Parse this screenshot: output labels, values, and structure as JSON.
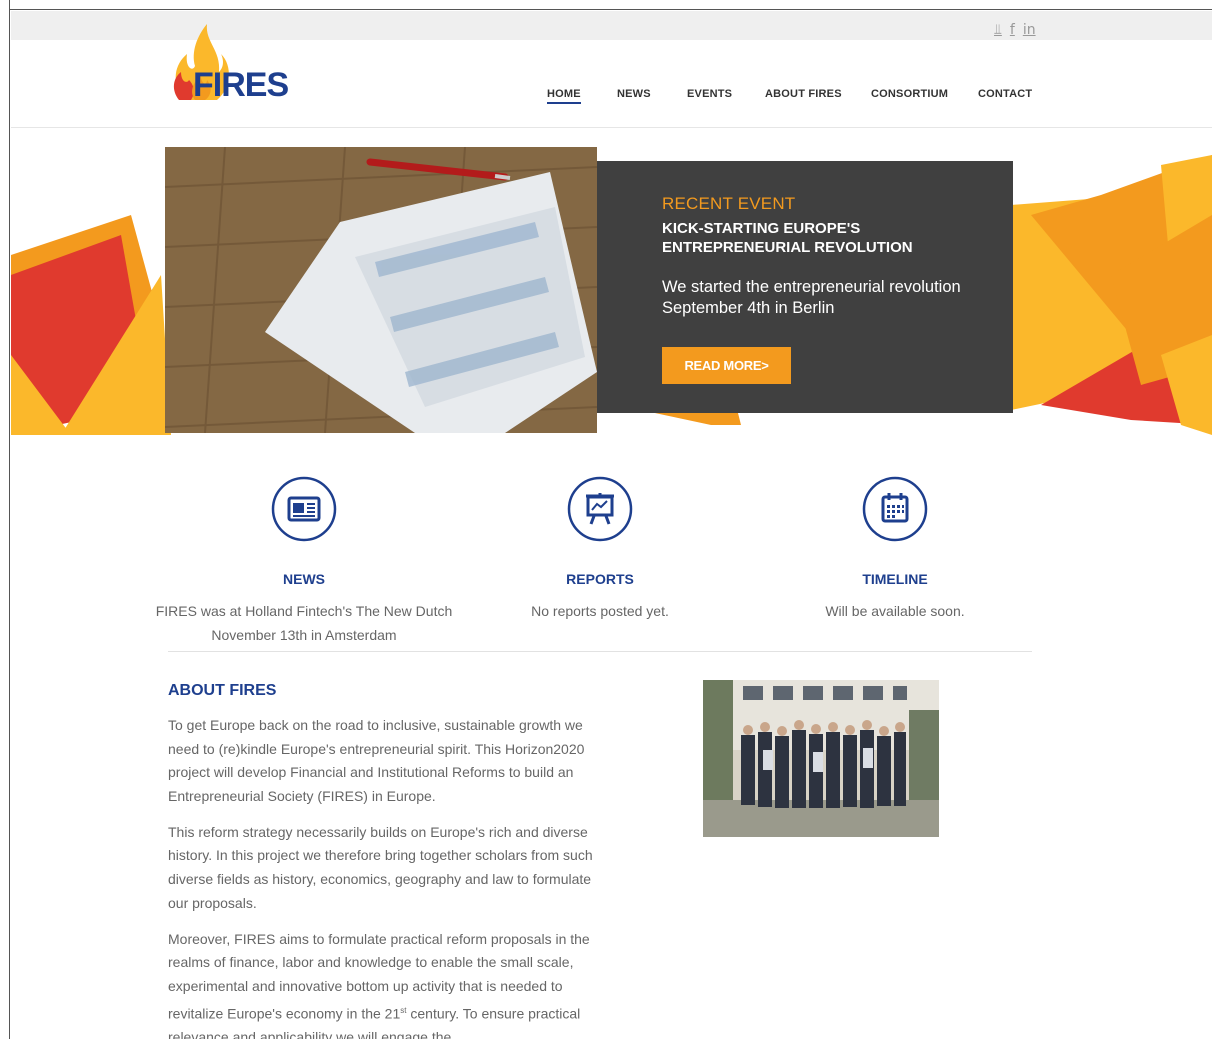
{
  "social": {
    "twitter": "⫫",
    "facebook": "f",
    "linkedin": "in"
  },
  "logo": {
    "text": "FIRES"
  },
  "nav": {
    "items": [
      {
        "label": "HOME",
        "active": true
      },
      {
        "label": "NEWS",
        "active": false
      },
      {
        "label": "EVENTS",
        "active": false
      },
      {
        "label": "ABOUT FIRES",
        "active": false
      },
      {
        "label": "CONSORTIUM",
        "active": false
      },
      {
        "label": "CONTACT",
        "active": false
      }
    ]
  },
  "hero": {
    "kicker": "RECENT EVENT",
    "title": "KICK-STARTING EUROPE'S ENTREPRENEURIAL REVOLUTION",
    "text": "We started the entrepreneurial revolution September 4th in Berlin",
    "button": "READ MORE>"
  },
  "features": [
    {
      "icon": "newspaper-icon",
      "title": "NEWS",
      "text": "FIRES was at Holland Fintech's The New Dutch November 13th in Amsterdam"
    },
    {
      "icon": "presentation-chart-icon",
      "title": "REPORTS",
      "text": "No reports posted yet."
    },
    {
      "icon": "calendar-icon",
      "title": "TIMELINE",
      "text": "Will be available soon."
    }
  ],
  "about": {
    "title": "ABOUT FIRES",
    "p1": "To get Europe back on the road to inclusive, sustainable growth we need to (re)kindle Europe's entrepreneurial spirit. This Horizon2020 project will develop Financial and Institutional Reforms to build an Entrepreneurial Society (FIRES) in Europe.",
    "p2": "This reform strategy necessarily builds on Europe's rich and diverse history. In this project we therefore bring together scholars from such diverse fields as history, economics, geography and law to formulate our proposals.",
    "p3_a": "Moreover, FIRES aims to formulate practical reform proposals in the realms of finance, labor and knowledge to enable the small scale, experimental and innovative bottom up activity that is needed to revitalize Europe's economy in the 21",
    "p3_sup": "st",
    "p3_b": " century. To ensure practical relevance and applicability we will engage the"
  },
  "colors": {
    "brand_blue": "#1e3f8e",
    "accent_orange": "#f39a1e",
    "card_dark": "#404040",
    "flame_red": "#e03a2e",
    "flame_yellow": "#fbb82b"
  }
}
